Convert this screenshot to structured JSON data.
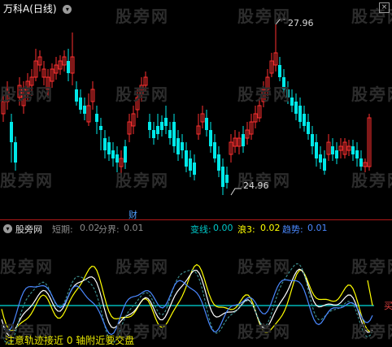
{
  "window": {
    "title": "万科A(日线)",
    "close_icon": "close-icon"
  },
  "price_chart": {
    "high_label": "27.96",
    "low_label": "24.96",
    "cai_label": "财",
    "colors": {
      "up": "#ff3030",
      "down": "#00e8e8",
      "grid": "#3a0000"
    }
  },
  "watermark": "股旁网",
  "indicator": {
    "name": "股旁网",
    "items": [
      {
        "label": "短期:",
        "value": "0.02",
        "color": "#808080"
      },
      {
        "label": "分界:",
        "value": "0.01",
        "color": "#808080"
      },
      {
        "label": "变线:",
        "value": "0.00",
        "color": "#00c8c8"
      },
      {
        "label": "浪3:",
        "value": "0.02",
        "color": "#ffff00"
      },
      {
        "label": "趋势:",
        "value": "0.01",
        "color": "#4a88ff"
      }
    ],
    "note": "注意轨迹接近 0 轴附近要交盘",
    "right_mark": "买"
  }
}
